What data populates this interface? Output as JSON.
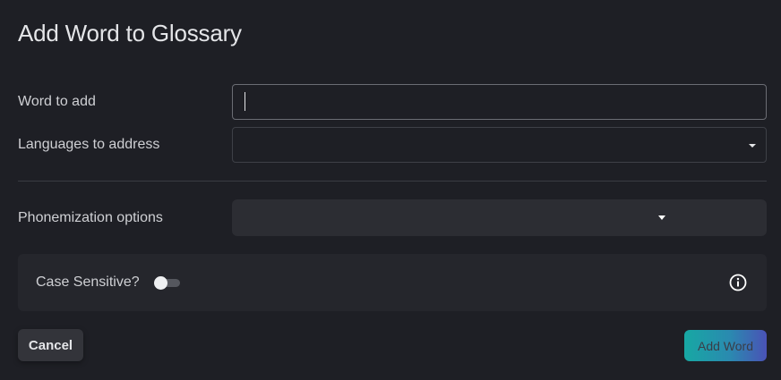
{
  "dialog": {
    "title": "Add Word to Glossary"
  },
  "form": {
    "word_label": "Word to add",
    "word_value": "",
    "languages_label": "Languages to address",
    "languages_value": "",
    "phonemization_label": "Phonemization options",
    "phonemization_value": "",
    "case_sensitive_label": "Case Sensitive?",
    "case_sensitive_on": false
  },
  "icons": {
    "dropdown": "chevron-down-icon",
    "info": "info-icon"
  },
  "actions": {
    "cancel_label": "Cancel",
    "add_label": "Add Word"
  },
  "colors": {
    "background": "#1e1f25",
    "panel": "#25262c",
    "accent_start": "#17a8a3",
    "accent_end": "#4a52b6"
  }
}
